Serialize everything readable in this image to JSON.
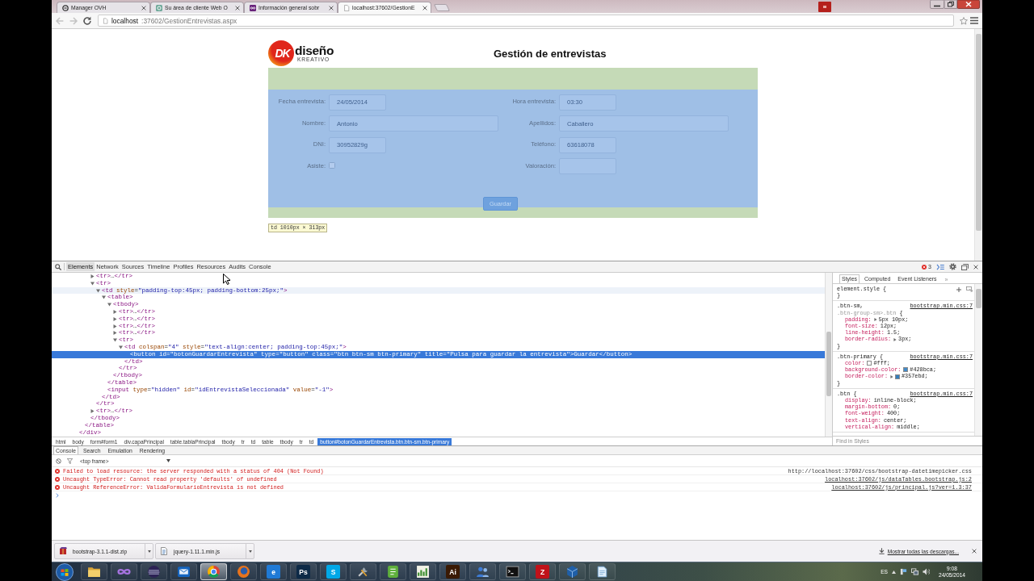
{
  "browser": {
    "tabs": [
      {
        "title": "Manager OVH",
        "kind": "ring",
        "selected": false
      },
      {
        "title": "Su área de cliente Web O",
        "kind": "badge",
        "selected": false
      },
      {
        "title": "Información general sobr",
        "kind": "loop",
        "selected": false
      },
      {
        "title": "localhost:37602/GestionE",
        "kind": "page",
        "selected": true
      }
    ],
    "nav": [
      {
        "kind": "back",
        "disabled": true
      },
      {
        "kind": "forward",
        "disabled": true
      },
      {
        "kind": "reload",
        "disabled": false
      }
    ],
    "address": {
      "host": "localhost",
      "path": ":37602/GestionEntrevistas.aspx"
    }
  },
  "page": {
    "logo": {
      "mark": "DK",
      "name": "diseño",
      "tagline": "KREATIVO"
    },
    "title": "Gestión de entrevistas",
    "form": {
      "fields": [
        {
          "label": "Fecha entrevista:",
          "kind": "short",
          "value": "24/05/2014"
        },
        {
          "label": "Hora entrevista:",
          "kind": "short",
          "value": "03:30"
        },
        {
          "label": "Nombre:",
          "kind": "wide",
          "value": "Antonio"
        },
        {
          "label": "Apellidos:",
          "kind": "wide",
          "value": "Caballero"
        },
        {
          "label": "DNI:",
          "kind": "short",
          "value": "30952829g"
        },
        {
          "label": "Teléfono:",
          "kind": "short",
          "value": "63618078"
        },
        {
          "label": "Asiste:",
          "kind": "checkbox",
          "checked": false
        },
        {
          "label": "Valoración:",
          "kind": "short"
        }
      ],
      "button": "Guardar"
    },
    "inspect_tooltip": "td 1010px × 313px"
  },
  "devtools": {
    "tabs": [
      {
        "label": "Elements",
        "selected": true
      },
      {
        "label": "Network",
        "selected": false
      },
      {
        "label": "Sources",
        "selected": false
      },
      {
        "label": "Timeline",
        "selected": false
      },
      {
        "label": "Profiles",
        "selected": false
      },
      {
        "label": "Resources",
        "selected": false
      },
      {
        "label": "Audits",
        "selected": false
      },
      {
        "label": "Console",
        "selected": false
      }
    ],
    "error_count": "3",
    "dom_tree": [
      {
        "close": "</div>",
        "children": [
          {
            "close": "</table>",
            "children": [
              {
                "close": "</tbody>",
                "children": [
                  {
                    "open": "<tr>…</tr>",
                    "expanded": false,
                    "selected": false,
                    "hovered": false
                  },
                  {
                    "open": "<tr>",
                    "close": "</tr>",
                    "expanded": true,
                    "selected": false,
                    "hovered": false,
                    "children": [
                      {
                        "open": "<td style=\"padding-top:45px; padding-bottom:25px;\">",
                        "close": "</td>",
                        "expanded": true,
                        "selected": false,
                        "hovered": true,
                        "children": [
                          {
                            "open": "<table>",
                            "close": "</table>",
                            "expanded": true,
                            "selected": false,
                            "hovered": false,
                            "children": [
                              {
                                "open": "<tbody>",
                                "close": "</tbody>",
                                "expanded": true,
                                "selected": false,
                                "hovered": false,
                                "children": [
                                  {
                                    "open": "<tr>…</tr>",
                                    "expanded": false,
                                    "selected": false,
                                    "hovered": false
                                  },
                                  {
                                    "open": "<tr>…</tr>",
                                    "expanded": false,
                                    "selected": false,
                                    "hovered": false
                                  },
                                  {
                                    "open": "<tr>…</tr>",
                                    "expanded": false,
                                    "selected": false,
                                    "hovered": false
                                  },
                                  {
                                    "open": "<tr>…</tr>",
                                    "expanded": false,
                                    "selected": false,
                                    "hovered": false
                                  },
                                  {
                                    "open": "<tr>",
                                    "close": "</tr>",
                                    "expanded": true,
                                    "selected": false,
                                    "hovered": false,
                                    "children": [
                                      {
                                        "open": "<td colspan=\"4\" style=\"text-align:center; padding-top:45px;\">",
                                        "close": "</td>",
                                        "expanded": true,
                                        "selected": false,
                                        "hovered": false,
                                        "children": [
                                          {
                                            "open": "<button id=\"botonGuardarEntrevista\" type=\"button\" class=\"btn btn-sm btn-primary\" title=\"Pulsa para guardar la entrevista\">Guardar</button>",
                                            "selected": true,
                                            "hovered": false
                                          }
                                        ]
                                      }
                                    ]
                                  }
                                ]
                              }
                            ]
                          },
                          {
                            "open": "<input type=\"hidden\" id=\"idEntrevistaSeleccionada\" value=\"-1\">",
                            "selected": false,
                            "hovered": false
                          }
                        ]
                      }
                    ]
                  },
                  {
                    "open": "<tr>…</tr>",
                    "expanded": false,
                    "selected": false,
                    "hovered": false
                  }
                ]
              }
            ]
          }
        ]
      }
    ],
    "breadcrumbs": [
      {
        "label": "html",
        "selected": false
      },
      {
        "label": "body",
        "selected": false
      },
      {
        "label": "form#form1",
        "selected": false
      },
      {
        "label": "div.capaPrincipal",
        "selected": false
      },
      {
        "label": "table.tablaPrincipal",
        "selected": false
      },
      {
        "label": "tbody",
        "selected": false
      },
      {
        "label": "tr",
        "selected": false
      },
      {
        "label": "td",
        "selected": false
      },
      {
        "label": "table",
        "selected": false
      },
      {
        "label": "tbody",
        "selected": false
      },
      {
        "label": "tr",
        "selected": false
      },
      {
        "label": "td",
        "selected": false
      },
      {
        "label": "button#botonGuardarEntrevista.btn.btn-sm.btn-primary",
        "selected": true
      }
    ],
    "styles": {
      "tabs": [
        {
          "label": "Styles",
          "selected": true
        },
        {
          "label": "Computed",
          "selected": false
        },
        {
          "label": "Event Listeners",
          "selected": false
        }
      ],
      "overflow": "»",
      "rules": [
        {
          "kind": "inline",
          "selector": [
            {
              "text": "element.style {",
              "matched": true
            }
          ],
          "close": "}"
        },
        {
          "kind": "matched",
          "selector": [
            {
              "text": ".btn-sm,",
              "matched": true
            },
            {
              "text": ".btn-group-sm>.btn",
              "matched": false
            },
            {
              "text": "{",
              "matched": true
            }
          ],
          "source": "bootstrap.min.css:7",
          "declarations": [
            {
              "name": "padding:",
              "value": "5px 10px;",
              "expanded": false
            },
            {
              "name": "font-size:",
              "value": "12px;"
            },
            {
              "name": "line-height:",
              "value": "1.5;"
            },
            {
              "name": "border-radius:",
              "value": "3px;",
              "expanded": false
            }
          ],
          "close": "}"
        },
        {
          "kind": "matched",
          "selector": [
            {
              "text": ".btn-primary {",
              "matched": true
            }
          ],
          "source": "bootstrap.min.css:7",
          "declarations": [
            {
              "name": "color:",
              "value": "#fff;",
              "color": "#ffffff"
            },
            {
              "name": "background-color:",
              "value": "#428bca;",
              "color": "#428bca"
            },
            {
              "name": "border-color:",
              "value": "#357ebd;",
              "expanded": false,
              "color": "#357ebd"
            }
          ],
          "close": "}"
        },
        {
          "kind": "matched",
          "selector": [
            {
              "text": ".btn {",
              "matched": true
            }
          ],
          "source": "bootstrap.min.css:7",
          "declarations": [
            {
              "name": "display:",
              "value": "inline-block;"
            },
            {
              "name": "margin-bottom:",
              "value": "0;"
            },
            {
              "name": "font-weight:",
              "value": "400;"
            },
            {
              "name": "text-align:",
              "value": "center;"
            },
            {
              "name": "vertical-align:",
              "value": "middle;"
            }
          ]
        }
      ],
      "filter": {
        "placeholder": "Find in Styles"
      }
    },
    "drawer": {
      "tabs": [
        {
          "label": "Console",
          "selected": true
        },
        {
          "label": "Search",
          "selected": false
        },
        {
          "label": "Emulation",
          "selected": false
        },
        {
          "label": "Rendering",
          "selected": false
        }
      ],
      "context": "<top frame>",
      "messages": [
        {
          "kind": "error",
          "text": "Failed to load resource: the server responded with a status of 404 (Not Found)",
          "source": "http://localhost:37602/css/bootstrap-datetimepicker.css",
          "linked": false
        },
        {
          "kind": "error",
          "text": "Uncaught TypeError: Cannot read property 'defaults' of undefined",
          "source": "localhost:37602/js/dataTables.bootstrap.js:2",
          "linked": true
        },
        {
          "kind": "error",
          "text": "Uncaught ReferenceError: ValidaFormularioEntrevista is not defined",
          "source": "localhost:37602/js/principal.js?ver=1.3:37",
          "linked": true
        }
      ]
    }
  },
  "downloads": {
    "items": [
      {
        "name": "bootstrap-3.1.1-dist.zip",
        "kind": "archive"
      },
      {
        "name": "jquery-1.11.1.min.js",
        "kind": "script"
      }
    ],
    "show_all": "Mostrar todas las descargas..."
  },
  "taskbar": {
    "apps": [
      {
        "kind": "folder",
        "active": false
      },
      {
        "kind": "loop",
        "active": false
      },
      {
        "kind": "sphere",
        "active": false
      },
      {
        "kind": "mail",
        "active": false
      },
      {
        "kind": "pinwheel",
        "active": true
      },
      {
        "kind": "globe",
        "active": false
      },
      {
        "kind": "letter",
        "label": "e",
        "color": "#1f7ad6",
        "active": false
      },
      {
        "kind": "letter",
        "label": "Ps",
        "color": "#0d2a47",
        "active": false
      },
      {
        "kind": "letter",
        "label": "S",
        "color": "#00a8e8",
        "active": false
      },
      {
        "kind": "tools",
        "active": false
      },
      {
        "kind": "note",
        "active": false
      },
      {
        "kind": "chart",
        "active": false
      },
      {
        "kind": "letter",
        "label": "Ai",
        "color": "#3a1a05",
        "active": false
      },
      {
        "kind": "people",
        "active": false
      },
      {
        "kind": "terminal",
        "active": false
      },
      {
        "kind": "letter",
        "label": "Z",
        "color": "#c0121a",
        "active": false
      },
      {
        "kind": "cube",
        "active": false
      },
      {
        "kind": "pages",
        "active": false
      }
    ],
    "language": "ES",
    "time": "9:08",
    "date": "24/05/2014"
  }
}
